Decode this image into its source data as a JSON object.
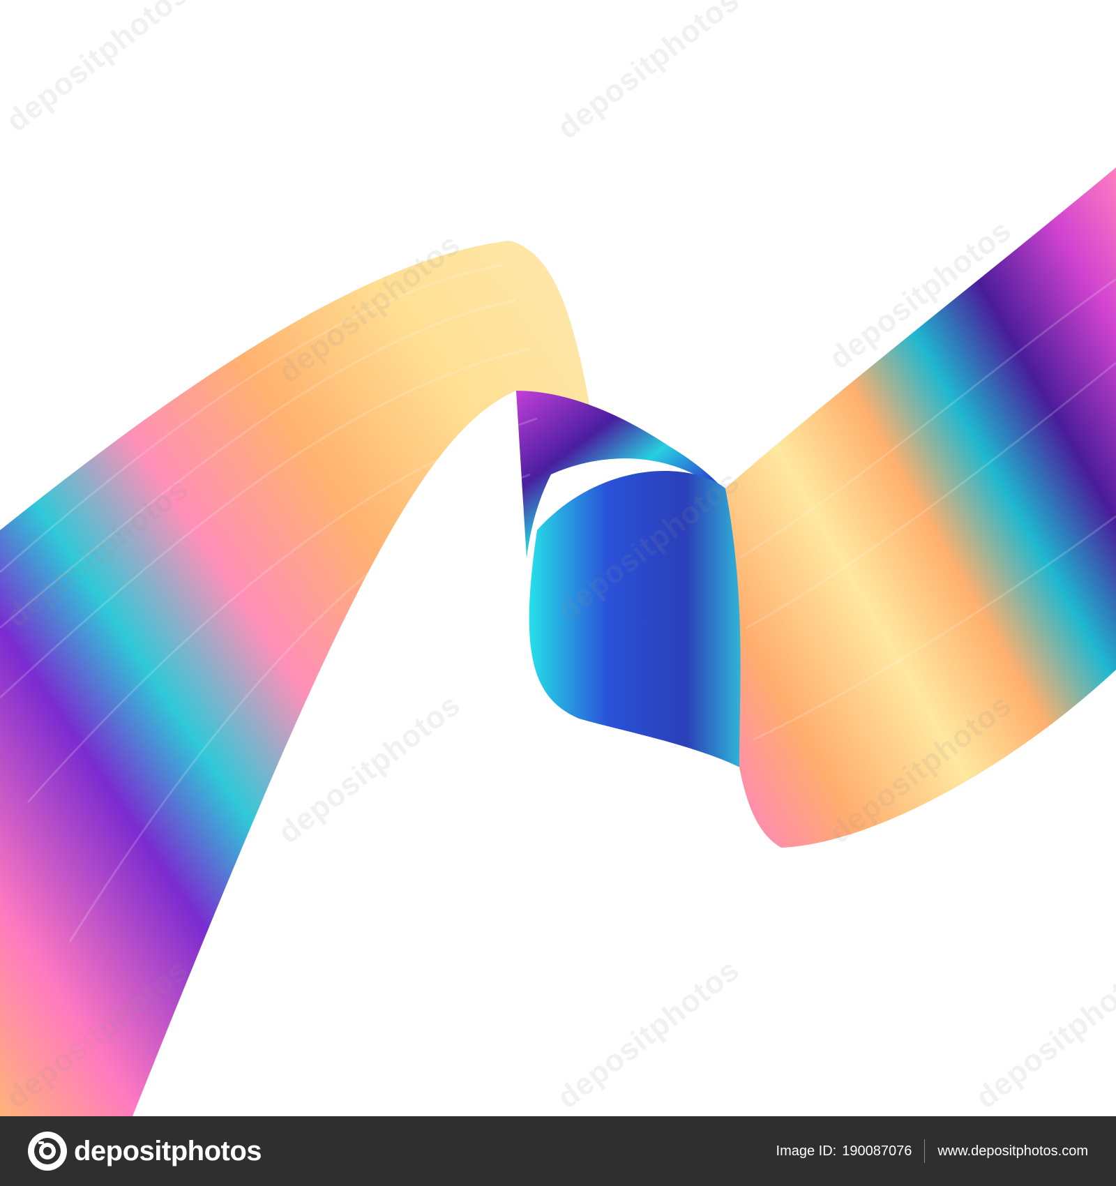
{
  "image": {
    "subject": "abstract-iridescent-ribbon",
    "colors": {
      "yellow": "#ffe08a",
      "orange": "#ffab6b",
      "pink": "#ff6fb0",
      "magenta": "#c23fd8",
      "purple": "#5a1fa8",
      "blue": "#2a3fc8",
      "cyan": "#28d8e0",
      "background": "#ffffff"
    }
  },
  "watermark": {
    "text": "depositphotos"
  },
  "footer": {
    "background": "#2f2f2f",
    "logo_icon": "camera-aperture-icon",
    "brand": "depositphotos",
    "image_id_label": "Image ID:",
    "image_id": "190087076",
    "url": "www.depositphotos.com"
  }
}
